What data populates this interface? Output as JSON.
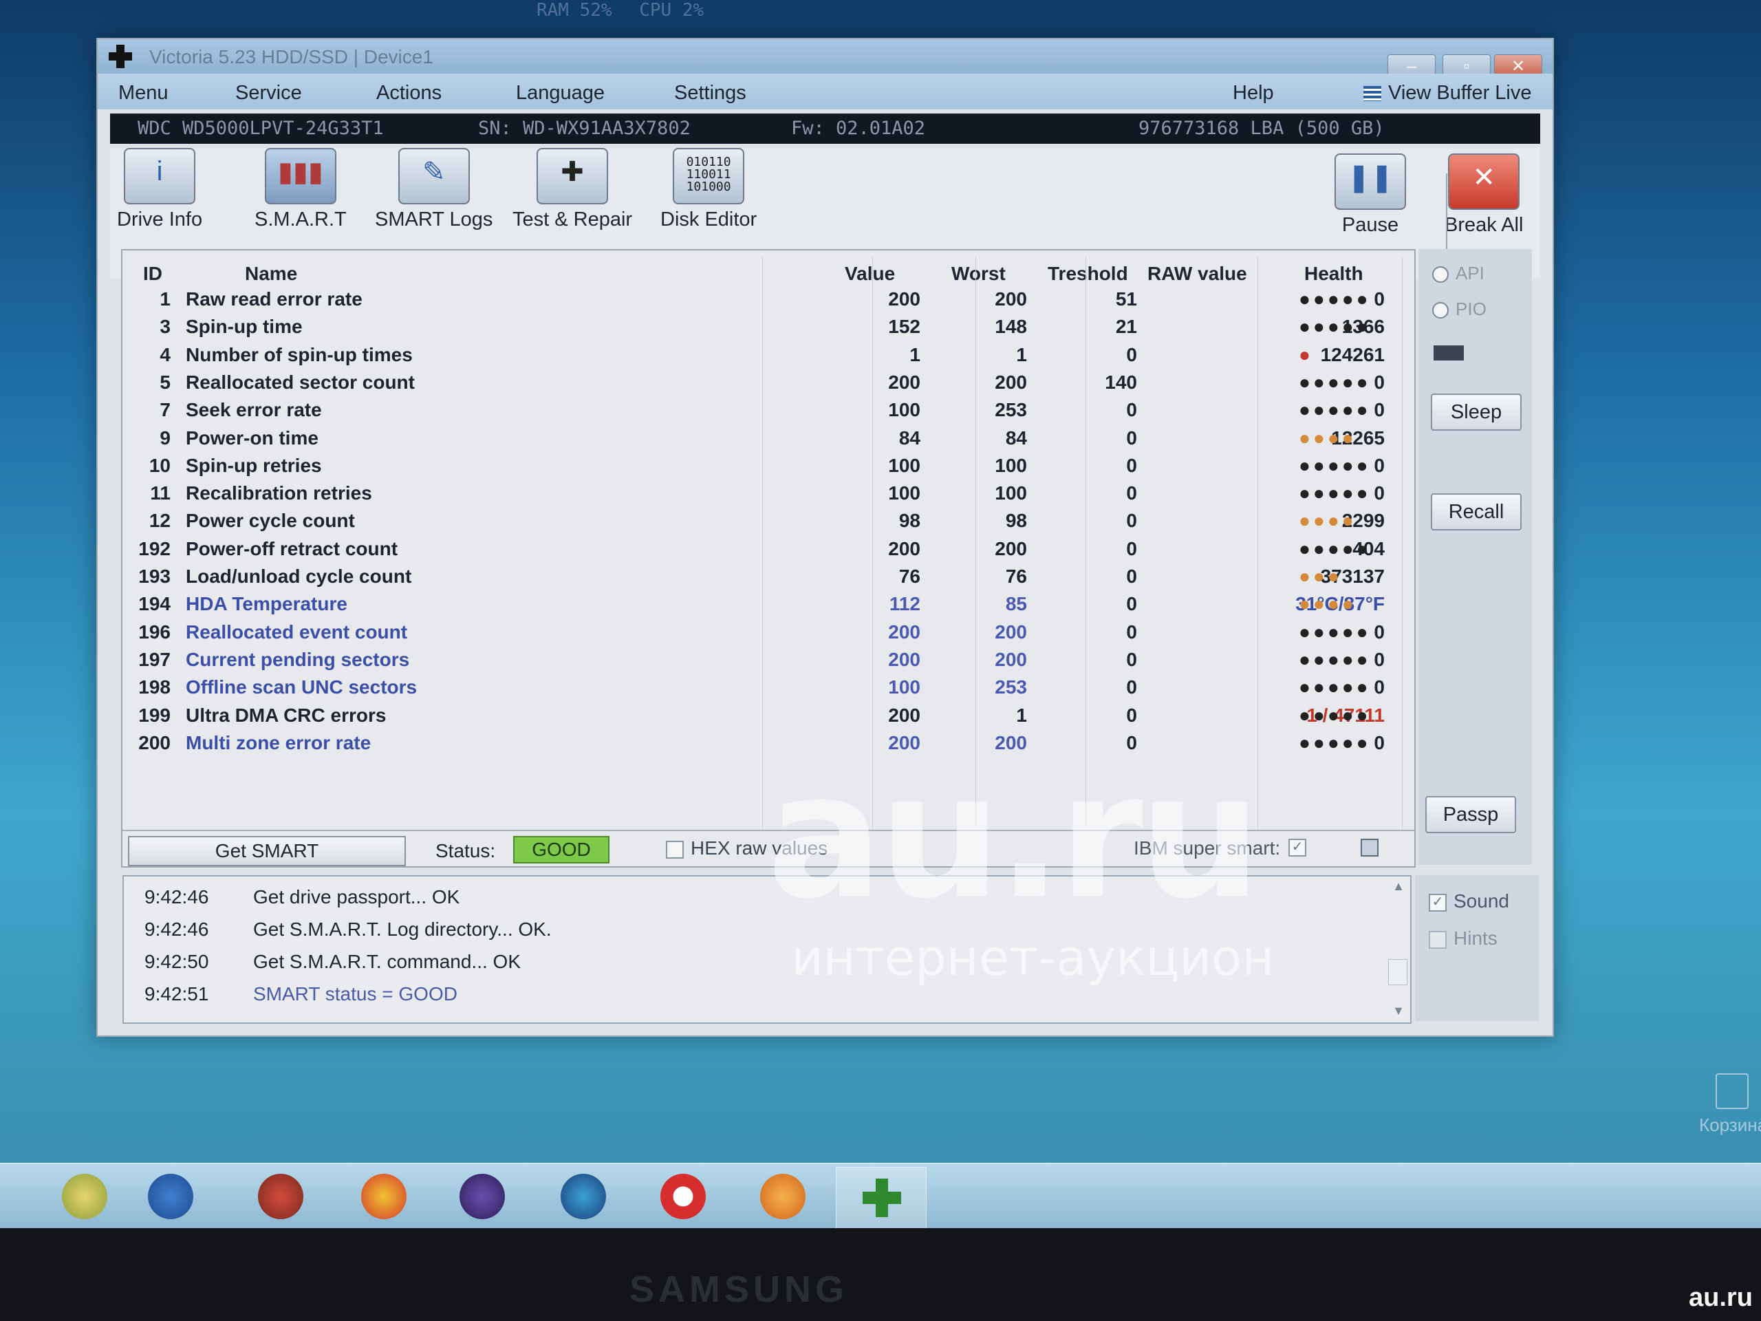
{
  "top_overlay": {
    "a": "RAM 52%",
    "b": "CPU 2%"
  },
  "window": {
    "title": "Victoria 5.23 HDD/SSD | Device1"
  },
  "menu": {
    "items": [
      "Menu",
      "Service",
      "Actions",
      "Language",
      "Settings"
    ],
    "help": "Help",
    "view_buffer": "View Buffer Live"
  },
  "drive": {
    "model": "WDC WD5000LPVT-24G33T1",
    "serial": "SN: WD-WX91AA3X7802",
    "firmware": "Fw: 02.01A02",
    "capacity": "976773168 LBA (500 GB)"
  },
  "toolbar": {
    "drive_info": "Drive Info",
    "smart": "S.M.A.R.T",
    "smart_logs": "SMART Logs",
    "test_repair": "Test & Repair",
    "disk_editor": "Disk Editor",
    "pause": "Pause",
    "break_all": "Break All"
  },
  "table": {
    "headers": {
      "id": "ID",
      "name": "Name",
      "value": "Value",
      "worst": "Worst",
      "threshold": "Treshold",
      "raw": "RAW value",
      "health": "Health"
    },
    "rows": [
      {
        "id": "1",
        "name": "Raw read error rate",
        "value": "200",
        "worst": "200",
        "threshold": "51",
        "raw": "0",
        "health": "●●●●●",
        "health_color": "#222222",
        "raw_color": "#1c2430",
        "style": "dark"
      },
      {
        "id": "3",
        "name": "Spin-up time",
        "value": "152",
        "worst": "148",
        "threshold": "21",
        "raw": "1366",
        "health": "●●●●●",
        "health_color": "#222222",
        "raw_color": "#1c2430",
        "style": "dark"
      },
      {
        "id": "4",
        "name": "Number of spin-up times",
        "value": "1",
        "worst": "1",
        "threshold": "0",
        "raw": "124261",
        "health": "●",
        "health_color": "#c0392b",
        "raw_color": "#1c2430",
        "style": "dark"
      },
      {
        "id": "5",
        "name": "Reallocated sector count",
        "value": "200",
        "worst": "200",
        "threshold": "140",
        "raw": "0",
        "health": "●●●●●",
        "health_color": "#222222",
        "raw_color": "#1c2430",
        "style": "dark"
      },
      {
        "id": "7",
        "name": "Seek error rate",
        "value": "100",
        "worst": "253",
        "threshold": "0",
        "raw": "0",
        "health": "●●●●●",
        "health_color": "#222222",
        "raw_color": "#1c2430",
        "style": "dark"
      },
      {
        "id": "9",
        "name": "Power-on time",
        "value": "84",
        "worst": "84",
        "threshold": "0",
        "raw": "12265",
        "health": "●●●●",
        "health_color": "#d58a3a",
        "raw_color": "#1c2430",
        "style": "dark"
      },
      {
        "id": "10",
        "name": "Spin-up retries",
        "value": "100",
        "worst": "100",
        "threshold": "0",
        "raw": "0",
        "health": "●●●●●",
        "health_color": "#222222",
        "raw_color": "#1c2430",
        "style": "dark"
      },
      {
        "id": "11",
        "name": "Recalibration retries",
        "value": "100",
        "worst": "100",
        "threshold": "0",
        "raw": "0",
        "health": "●●●●●",
        "health_color": "#222222",
        "raw_color": "#1c2430",
        "style": "dark"
      },
      {
        "id": "12",
        "name": "Power cycle count",
        "value": "98",
        "worst": "98",
        "threshold": "0",
        "raw": "2299",
        "health": "●●●●",
        "health_color": "#d58a3a",
        "raw_color": "#1c2430",
        "style": "dark"
      },
      {
        "id": "192",
        "name": "Power-off retract count",
        "value": "200",
        "worst": "200",
        "threshold": "0",
        "raw": "404",
        "health": "●●●●●",
        "health_color": "#222222",
        "raw_color": "#1c2430",
        "style": "dark"
      },
      {
        "id": "193",
        "name": "Load/unload cycle count",
        "value": "76",
        "worst": "76",
        "threshold": "0",
        "raw": "373137",
        "health": "●●●",
        "health_color": "#d58a3a",
        "raw_color": "#1c2430",
        "style": "dark"
      },
      {
        "id": "194",
        "name": "HDA Temperature",
        "value": "112",
        "worst": "85",
        "threshold": "0",
        "raw": "31°C/87°F",
        "health": "●●●●",
        "health_color": "#d58a3a",
        "raw_color": "#3b4fa8",
        "style": "blue"
      },
      {
        "id": "196",
        "name": "Reallocated event count",
        "value": "200",
        "worst": "200",
        "threshold": "0",
        "raw": "0",
        "health": "●●●●●",
        "health_color": "#222222",
        "raw_color": "#1c2430",
        "style": "blue"
      },
      {
        "id": "197",
        "name": "Current pending sectors",
        "value": "200",
        "worst": "200",
        "threshold": "0",
        "raw": "0",
        "health": "●●●●●",
        "health_color": "#222222",
        "raw_color": "#1c2430",
        "style": "blue"
      },
      {
        "id": "198",
        "name": "Offline scan UNC sectors",
        "value": "100",
        "worst": "253",
        "threshold": "0",
        "raw": "0",
        "health": "●●●●●",
        "health_color": "#222222",
        "raw_color": "#1c2430",
        "style": "blue"
      },
      {
        "id": "199",
        "name": "Ultra DMA CRC errors",
        "value": "200",
        "worst": "1",
        "threshold": "0",
        "raw": "1 / 47111",
        "health": "●●●●●",
        "health_color": "#222222",
        "raw_color": "#c0392b",
        "style": "dark"
      },
      {
        "id": "200",
        "name": "Multi zone error rate",
        "value": "200",
        "worst": "200",
        "threshold": "0",
        "raw": "0",
        "health": "●●●●●",
        "health_color": "#222222",
        "raw_color": "#1c2430",
        "style": "blue"
      }
    ]
  },
  "bottom": {
    "get_smart": "Get SMART",
    "status_label": "Status:",
    "status_value": "GOOD",
    "hex_raw": "HEX raw values",
    "ibm_super_smart": "IBM super smart:"
  },
  "side": {
    "api": "API",
    "pio": "PIO",
    "sleep": "Sleep",
    "recall": "Recall",
    "passp": "Passp",
    "sound": "Sound",
    "hints": "Hints"
  },
  "log": [
    {
      "time": "9:42:46",
      "msg": "Get drive passport... OK",
      "style": "dark"
    },
    {
      "time": "9:42:46",
      "msg": "Get S.M.A.R.T. Log directory... OK.",
      "style": "dark"
    },
    {
      "time": "9:42:50",
      "msg": "Get S.M.A.R.T. command... OK",
      "style": "dark"
    },
    {
      "time": "9:42:51",
      "msg": "SMART status = GOOD",
      "style": "blue"
    }
  ],
  "desktop": {
    "trash": "Корзина"
  },
  "bezel": {
    "brand": "SAMSUNG"
  },
  "watermark": {
    "big": "au.ru",
    "small": "интернет-аукцион",
    "corner": "au.ru"
  },
  "colors": {
    "status_good": "#7ec84a",
    "temp_blue": "#3b4fa8",
    "crc_red": "#c0392b",
    "warn_orange": "#d58a3a"
  }
}
